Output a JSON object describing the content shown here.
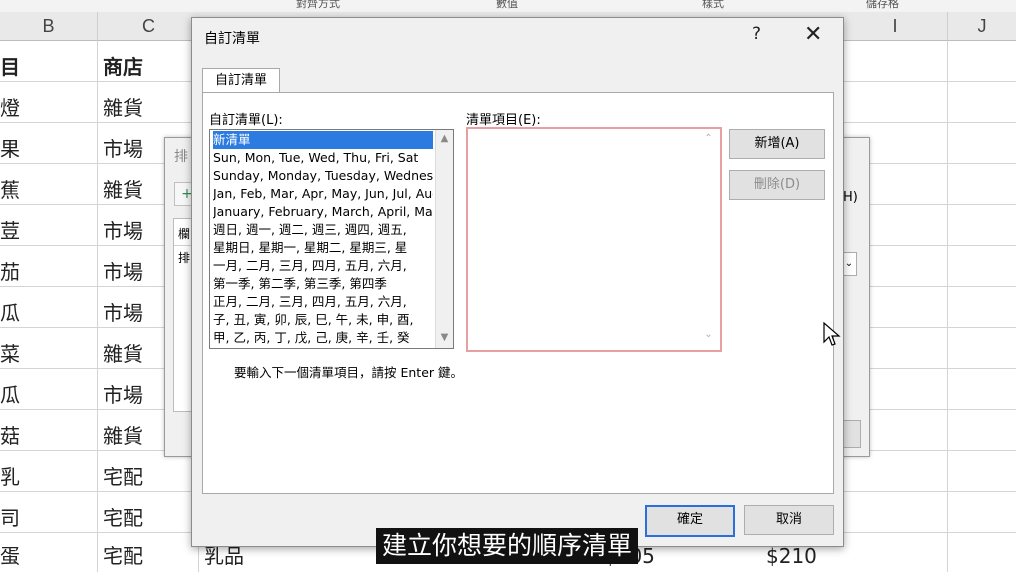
{
  "ribbon": {
    "groups": [
      "對齊方式",
      "數值",
      "樣式",
      "儲存格"
    ]
  },
  "columns": [
    "B",
    "C",
    "I",
    "J"
  ],
  "sheet": {
    "rows": [
      {
        "b": "目",
        "c": "商店",
        "d": "",
        "e": "",
        "f": ""
      },
      {
        "b": "燈",
        "c": "雜貨"
      },
      {
        "b": "果",
        "c": "市場"
      },
      {
        "b": "蕉",
        "c": "雜貨"
      },
      {
        "b": "荳",
        "c": "市場"
      },
      {
        "b": "茄",
        "c": "市場"
      },
      {
        "b": "瓜",
        "c": "市場"
      },
      {
        "b": "菜",
        "c": "雜貨"
      },
      {
        "b": "瓜",
        "c": "市場"
      },
      {
        "b": "菇",
        "c": "雜貨"
      },
      {
        "b": "乳",
        "c": "宅配"
      },
      {
        "b": "司",
        "c": "宅配"
      },
      {
        "b": "蛋",
        "c": "宅配",
        "d": "乳品",
        "e": "$105",
        "f": "$210"
      }
    ]
  },
  "sort_dialog": {
    "title_char": "排",
    "add_symbol": "+",
    "header_char": "欄",
    "row_char": "排",
    "h_key": "H)"
  },
  "dialog": {
    "title": "自訂清單",
    "help": "?",
    "close": "✕",
    "tab": "自訂清單",
    "lists_label": "自訂清單(L):",
    "entries_label": "清單項目(E):",
    "lists": [
      "新清單",
      "Sun, Mon, Tue, Wed, Thu, Fri, Sat",
      "Sunday, Monday, Tuesday, Wednesday",
      "Jan, Feb, Mar, Apr, May, Jun, Jul, Aug",
      "January, February, March, April, May",
      "週日, 週一, 週二, 週三, 週四, 週五,",
      "星期日, 星期一, 星期二, 星期三, 星",
      "一月, 二月, 三月, 四月, 五月, 六月,",
      "第一季, 第二季, 第三季, 第四季",
      "正月, 二月, 三月, 四月, 五月, 六月,",
      "子, 丑, 寅, 卯, 辰, 巳, 午, 未, 申, 酉,",
      "甲, 乙, 丙, 丁, 戊, 己, 庚, 辛, 壬, 癸"
    ],
    "add_button": "新增(A)",
    "delete_button": "刪除(D)",
    "hint": "要輸入下一個清單項目，請按 Enter 鍵。",
    "ok_button": "確定",
    "cancel_button": "取消"
  },
  "subtitle": "建立你想要的順序清單"
}
